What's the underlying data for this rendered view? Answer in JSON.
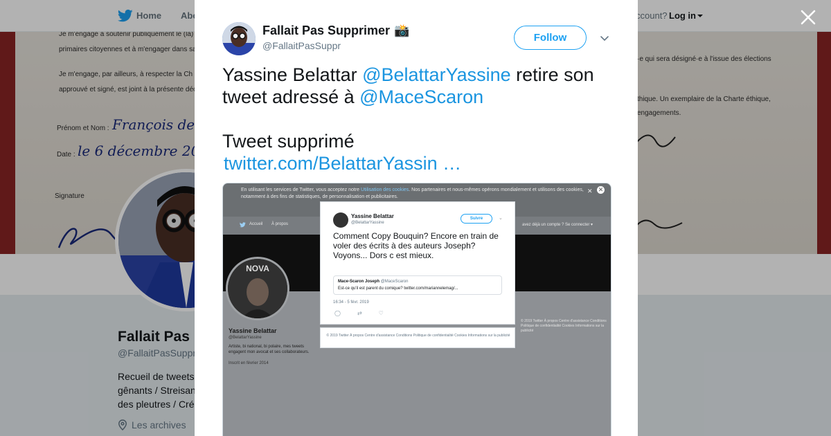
{
  "topnav": {
    "home_label": "Home",
    "about_label_partial": "Abo",
    "account_prompt_partial": "ccount?",
    "login_label": "Log in"
  },
  "banner": {
    "lines": [
      "Je m'engage à soutenir publiquement le (la)",
      "primaires citoyennes et à m'engager dans sa",
      "Je m'engage, par ailleurs, à respecter la Ch",
      "approuvé et signé, est joint à la présente décl",
      "Prénom et Nom :",
      "Date :",
      "Signature",
      "·e qui sera désigné·e à l'issue des élections",
      "thique. Un exemplaire de la Charte éthique,",
      "engagements."
    ],
    "handwriting": [
      "François de",
      "le 6 décembre 201"
    ]
  },
  "profile": {
    "name_partial": "Fallait Pas",
    "handle_partial": "@FallaitPasSuppr",
    "bio_lines": [
      "Recueil de tweets",
      "gênants / Streisan",
      "des pleutres / Cré"
    ],
    "location_label": "Les archives"
  },
  "tweet": {
    "author_name": "Fallait Pas Supprimer",
    "author_emoji": "📸",
    "author_handle": "@FallaitPasSuppr",
    "follow_label": "Follow",
    "text_part1": "Yassine Belattar ",
    "mention1": "@BelattarYassine",
    "text_part2": " retire son tweet adressé à ",
    "mention2": "@MaceScaron",
    "text_part3": "Tweet supprimé",
    "link": "twitter.com/BelattarYassin …"
  },
  "screenshot": {
    "cookie_text_1": "En utilisant les services de Twitter, vous acceptez notre ",
    "cookie_link": "Utilisation des cookies",
    "cookie_text_2": ". Nos partenaires et nous-mêmes opérons mondialement et utilisons des cookies, notamment à des fins de statistiques, de personnalisation et publicitaires.",
    "nav_home": "Accueil",
    "nav_about": "À propos",
    "nav_account": "avez déjà un compte ? Se connecter ▾",
    "profile_name": "Yassine Belattar",
    "profile_handle": "@BelattarYassine",
    "profile_bio": "Artiste, bi national, bi polaire, mes tweets engagent mon avocat et ses collaborateurs.",
    "profile_joined": "Inscrit en février 2014",
    "footer_right": "© 2019 Twitter   À propos   Centre d'assistance   Conditions   Politique de confidentialité   Cookies   Informations sur la publicité",
    "card": {
      "name": "Yassine Belattar",
      "handle": "@BelattarYassine",
      "follow_label": "Suivre",
      "text": "Comment Copy Bouquin? Encore en train de voler des écrits à des auteurs Joseph? Voyons... Dors c est mieux.",
      "quote_name": "Mace-Scaron Joseph",
      "quote_handle": "@MaceScaron",
      "quote_text": "Est-ce qu'il est parent du comique? twitter.com/mariannelemag/...",
      "time": "16:34 - 5 févr. 2019",
      "footer": "© 2019 Twitter   À propos   Centre d'assistance   Conditions   Politique de confidentialité   Cookies   Informations sur la publicité"
    }
  },
  "colors": {
    "accent": "#1da1f2",
    "link": "#1b95e0",
    "text": "#14171a",
    "muted": "#657786"
  }
}
